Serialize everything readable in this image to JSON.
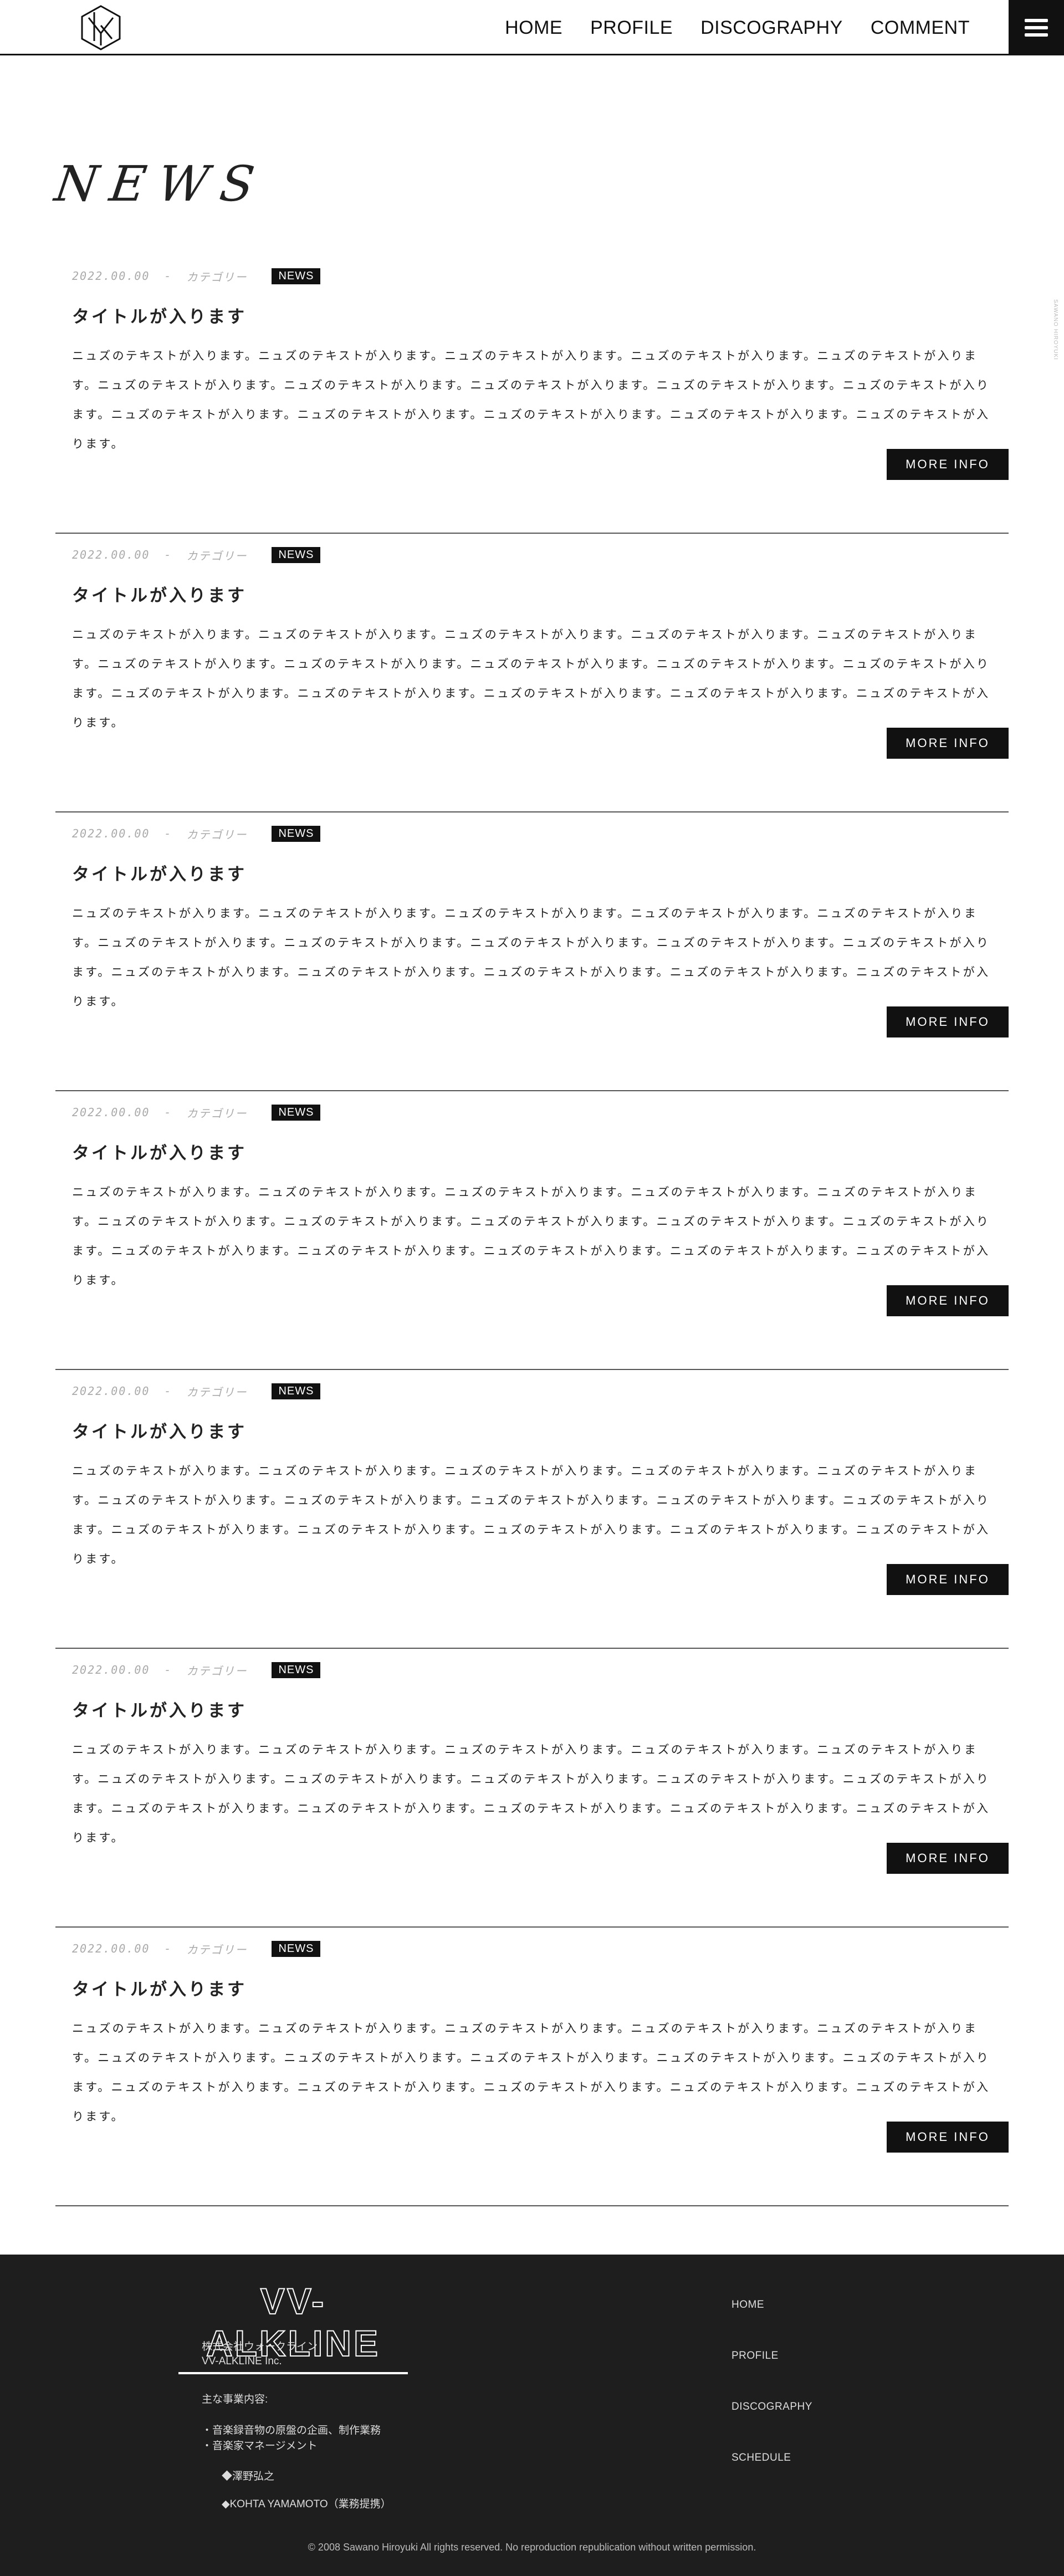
{
  "header": {
    "logo_alt": "site-logo",
    "nav": [
      {
        "label": "HOME"
      },
      {
        "label": "PROFILE"
      },
      {
        "label": "DISCOGRAPHY"
      },
      {
        "label": "COMMENT"
      }
    ],
    "menu_icon": "hamburger-icon"
  },
  "side_text": "SAWANO HIROYUKI",
  "page": {
    "title": "NEWS"
  },
  "news": [
    {
      "date": "2022.00.00",
      "separator": "-",
      "category": "カテゴリー",
      "badge": "NEWS",
      "title": "タイトルが入ります",
      "body": "ニュズのテキストが入ります。ニュズのテキストが入ります。ニュズのテキストが入ります。ニュズのテキストが入ります。ニュズのテキストが入ります。ニュズのテキストが入ります。ニュズのテキストが入ります。ニュズのテキストが入ります。ニュズのテキストが入ります。ニュズのテキストが入ります。ニュズのテキストが入ります。ニュズのテキストが入ります。ニュズのテキストが入ります。ニュズのテキストが入ります。ニュズのテキストが入ります。",
      "button": "MORE INFO"
    },
    {
      "date": "2022.00.00",
      "separator": "-",
      "category": "カテゴリー",
      "badge": "NEWS",
      "title": "タイトルが入ります",
      "body": "ニュズのテキストが入ります。ニュズのテキストが入ります。ニュズのテキストが入ります。ニュズのテキストが入ります。ニュズのテキストが入ります。ニュズのテキストが入ります。ニュズのテキストが入ります。ニュズのテキストが入ります。ニュズのテキストが入ります。ニュズのテキストが入ります。ニュズのテキストが入ります。ニュズのテキストが入ります。ニュズのテキストが入ります。ニュズのテキストが入ります。ニュズのテキストが入ります。",
      "button": "MORE INFO"
    },
    {
      "date": "2022.00.00",
      "separator": "-",
      "category": "カテゴリー",
      "badge": "NEWS",
      "title": "タイトルが入ります",
      "body": "ニュズのテキストが入ります。ニュズのテキストが入ります。ニュズのテキストが入ります。ニュズのテキストが入ります。ニュズのテキストが入ります。ニュズのテキストが入ります。ニュズのテキストが入ります。ニュズのテキストが入ります。ニュズのテキストが入ります。ニュズのテキストが入ります。ニュズのテキストが入ります。ニュズのテキストが入ります。ニュズのテキストが入ります。ニュズのテキストが入ります。ニュズのテキストが入ります。",
      "button": "MORE INFO"
    },
    {
      "date": "2022.00.00",
      "separator": "-",
      "category": "カテゴリー",
      "badge": "NEWS",
      "title": "タイトルが入ります",
      "body": "ニュズのテキストが入ります。ニュズのテキストが入ります。ニュズのテキストが入ります。ニュズのテキストが入ります。ニュズのテキストが入ります。ニュズのテキストが入ります。ニュズのテキストが入ります。ニュズのテキストが入ります。ニュズのテキストが入ります。ニュズのテキストが入ります。ニュズのテキストが入ります。ニュズのテキストが入ります。ニュズのテキストが入ります。ニュズのテキストが入ります。ニュズのテキストが入ります。",
      "button": "MORE INFO"
    },
    {
      "date": "2022.00.00",
      "separator": "-",
      "category": "カテゴリー",
      "badge": "NEWS",
      "title": "タイトルが入ります",
      "body": "ニュズのテキストが入ります。ニュズのテキストが入ります。ニュズのテキストが入ります。ニュズのテキストが入ります。ニュズのテキストが入ります。ニュズのテキストが入ります。ニュズのテキストが入ります。ニュズのテキストが入ります。ニュズのテキストが入ります。ニュズのテキストが入ります。ニュズのテキストが入ります。ニュズのテキストが入ります。ニュズのテキストが入ります。ニュズのテキストが入ります。ニュズのテキストが入ります。",
      "button": "MORE INFO"
    },
    {
      "date": "2022.00.00",
      "separator": "-",
      "category": "カテゴリー",
      "badge": "NEWS",
      "title": "タイトルが入ります",
      "body": "ニュズのテキストが入ります。ニュズのテキストが入ります。ニュズのテキストが入ります。ニュズのテキストが入ります。ニュズのテキストが入ります。ニュズのテキストが入ります。ニュズのテキストが入ります。ニュズのテキストが入ります。ニュズのテキストが入ります。ニュズのテキストが入ります。ニュズのテキストが入ります。ニュズのテキストが入ります。ニュズのテキストが入ります。ニュズのテキストが入ります。ニュズのテキストが入ります。",
      "button": "MORE INFO"
    },
    {
      "date": "2022.00.00",
      "separator": "-",
      "category": "カテゴリー",
      "badge": "NEWS",
      "title": "タイトルが入ります",
      "body": "ニュズのテキストが入ります。ニュズのテキストが入ります。ニュズのテキストが入ります。ニュズのテキストが入ります。ニュズのテキストが入ります。ニュズのテキストが入ります。ニュズのテキストが入ります。ニュズのテキストが入ります。ニュズのテキストが入ります。ニュズのテキストが入ります。ニュズのテキストが入ります。ニュズのテキストが入ります。ニュズのテキストが入ります。ニュズのテキストが入ります。ニュズのテキストが入ります。",
      "button": "MORE INFO"
    }
  ],
  "footer": {
    "brand": "VV-ALKLINE",
    "company_ja": "株式会社ウォークライン",
    "company_en": "VV-ALKLINE Inc.",
    "business_heading": "主な事業内容:",
    "business": [
      "・音楽録音物の原盤の企画、制作業務",
      "・音楽家マネージメント"
    ],
    "artists": [
      "◆澤野弘之",
      "◆KOHTA YAMAMOTO（業務提携）"
    ],
    "nav": [
      {
        "label": "HOME"
      },
      {
        "label": "PROFILE"
      },
      {
        "label": "DISCOGRAPHY"
      },
      {
        "label": "SCHEDULE"
      }
    ],
    "copyright": "© 2008 Sawano Hiroyuki All rights reserved. No reproduction republication without written permission."
  }
}
